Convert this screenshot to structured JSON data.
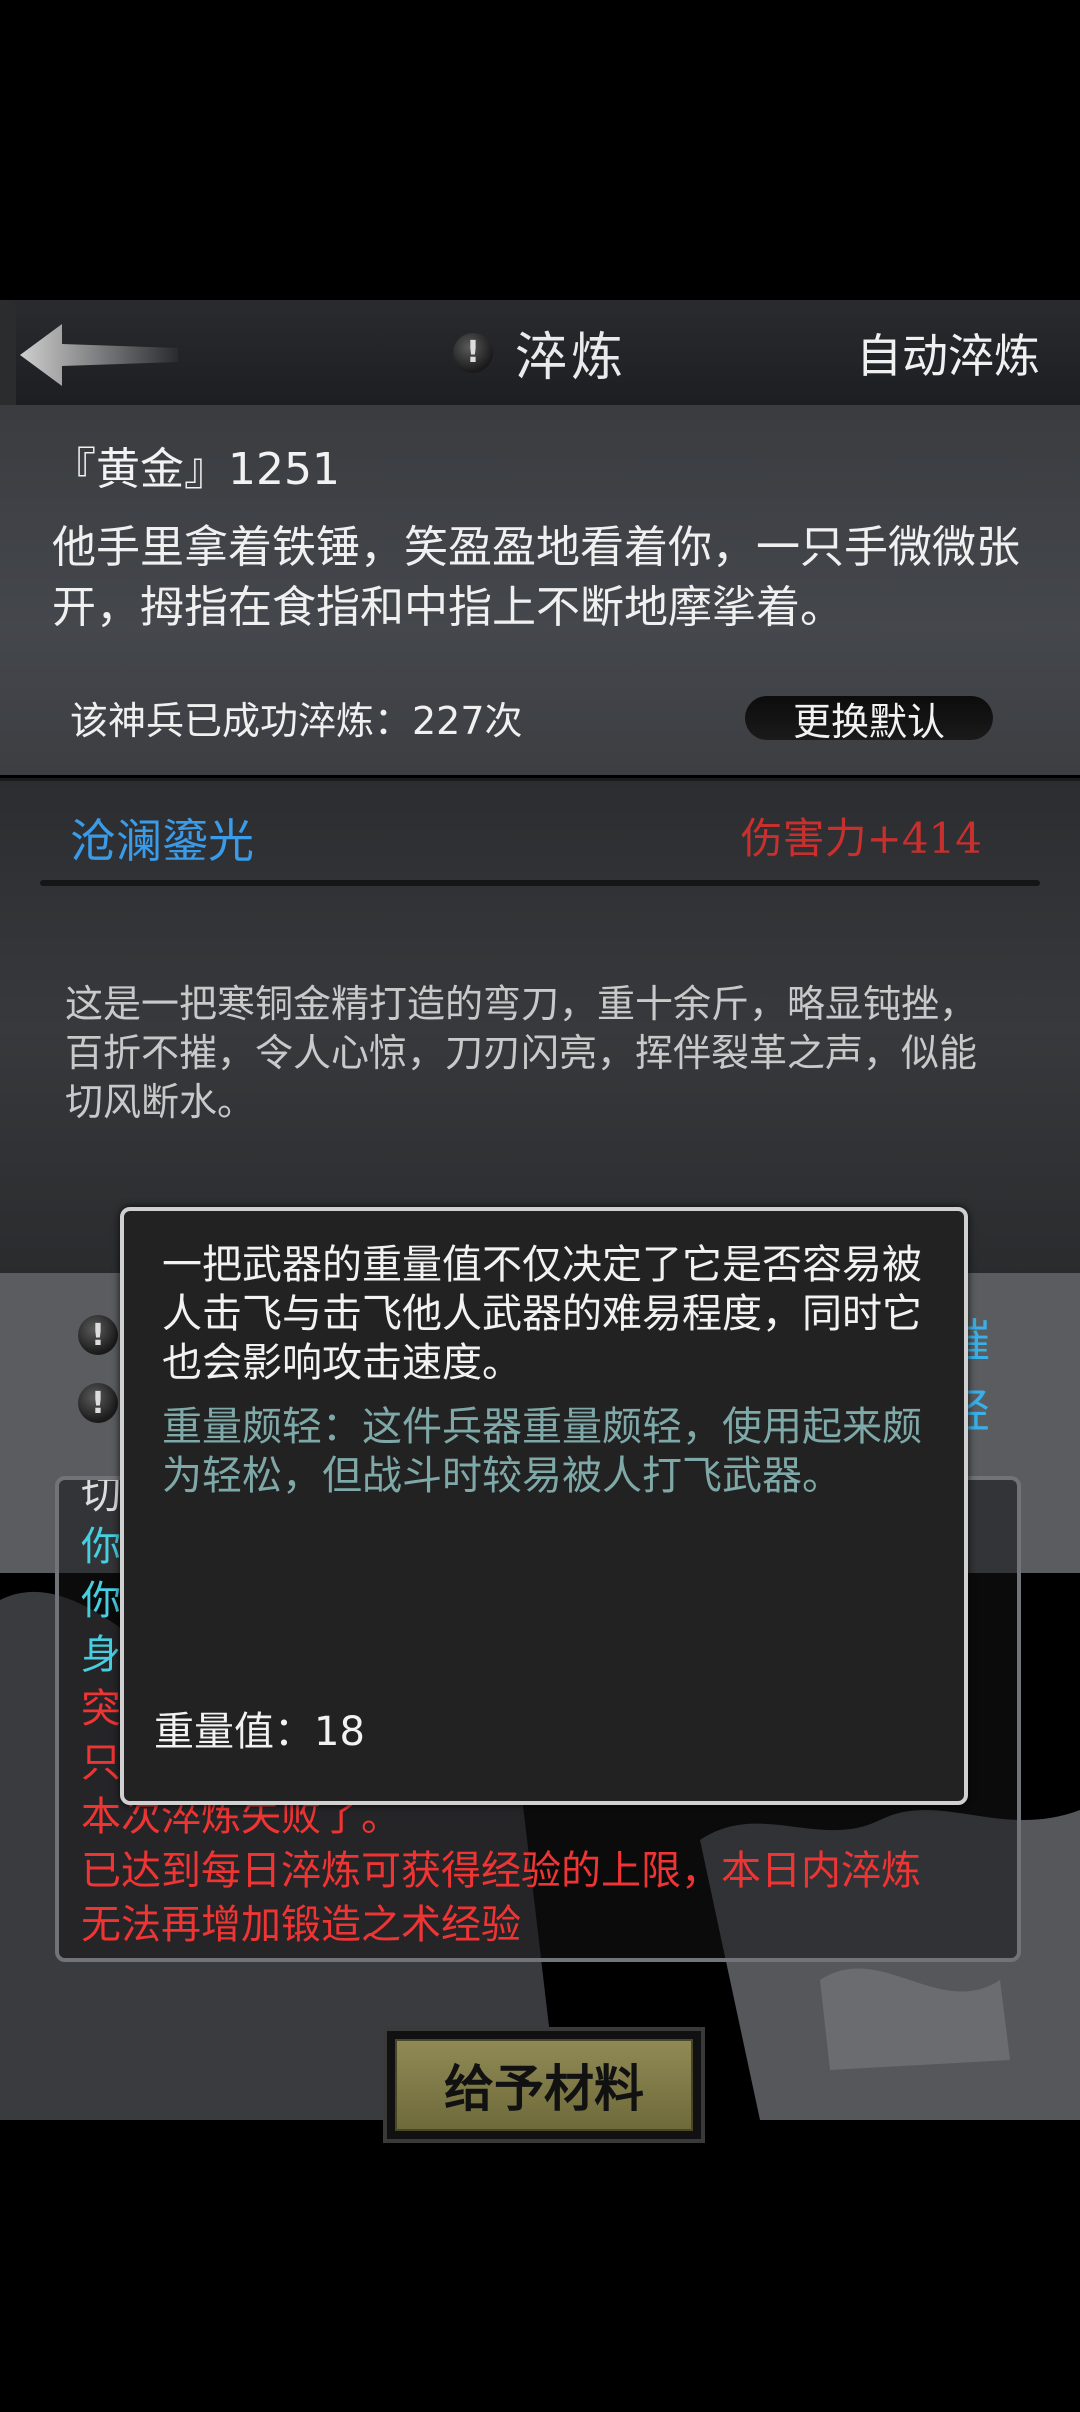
{
  "header": {
    "title": "淬炼",
    "auto_label": "自动淬炼"
  },
  "item": {
    "name": "『黄金』1251",
    "description": "他手里拿着铁锤，笑盈盈地看着你，一只手微微张开，拇指在食指和中指上不断地摩挲着。",
    "refine_count": "该神兵已成功淬炼：227次",
    "set_default_label": "更换默认"
  },
  "weapon": {
    "name": "沧澜鎏光",
    "stat": "伤害力+414",
    "description": "这是一把寒铜金精打造的弯刀，重十余斤，略显钝挫，百折不摧，令人心惊，刀刃闪亮，挥伴裂革之声，似能切风断水。"
  },
  "side_fragments": {
    "row1": "摧",
    "row2": "轻"
  },
  "log": {
    "partial": [
      "切",
      "你",
      "你",
      "身",
      "突",
      "只"
    ],
    "line_failed": "本次淬炼失败了。",
    "line_limit_1": "已达到每日淬炼可获得经验的上限，本日内淬炼",
    "line_limit_2": "无法再增加锻造之术经验"
  },
  "tooltip": {
    "main": "一把武器的重量值不仅决定了它是否容易被人击飞与击飞他人武器的难易程度，同时它也会影响攻击速度。",
    "effect": "重量颇轻：这件兵器重量颇轻，使用起来颇为轻松，但战斗时较易被人打飞武器。",
    "weight": "重量值：18"
  },
  "give_button": "给予材料",
  "colors": {
    "blue_name": "#3a9be8",
    "red_stat": "#c8302e",
    "cyan_log": "#46cfe0",
    "red_log": "#ef3434",
    "tip_effect": "#7fa9a8"
  }
}
